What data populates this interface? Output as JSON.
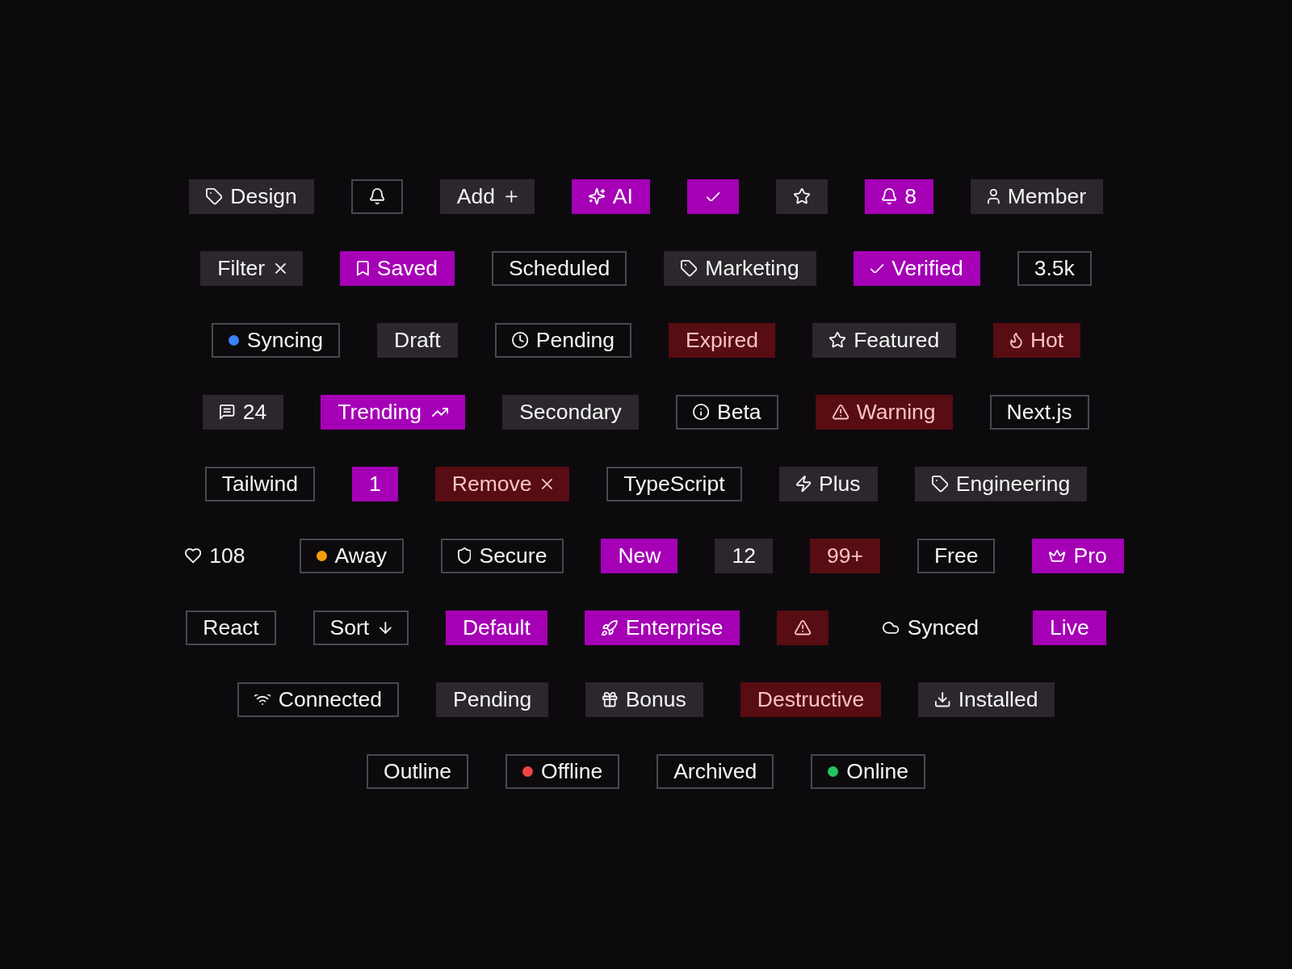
{
  "rows": [
    {
      "badges": [
        {
          "kind": "secondary",
          "label": "Design"
        },
        {
          "kind": "outline"
        },
        {
          "kind": "secondary",
          "label": "Add"
        },
        {
          "kind": "primary",
          "label": "AI"
        },
        {
          "kind": "primary"
        },
        {
          "kind": "secondary"
        },
        {
          "kind": "primary",
          "label": "8"
        },
        {
          "kind": "secondary",
          "label": "Member"
        }
      ]
    },
    {
      "badges": [
        {
          "kind": "secondary",
          "label": "Filter"
        },
        {
          "kind": "primary",
          "label": "Saved"
        },
        {
          "kind": "outline",
          "label": "Scheduled"
        },
        {
          "kind": "secondary",
          "label": "Marketing"
        },
        {
          "kind": "primary",
          "label": "Verified"
        },
        {
          "kind": "outline",
          "label": "3.5k"
        }
      ]
    },
    {
      "badges": [
        {
          "kind": "outline",
          "label": "Syncing",
          "color": "#3b82f6"
        },
        {
          "kind": "secondary",
          "label": "Draft"
        },
        {
          "kind": "outline",
          "label": "Pending"
        },
        {
          "kind": "destructive",
          "label": "Expired"
        },
        {
          "kind": "secondary",
          "label": "Featured"
        },
        {
          "kind": "destructive",
          "label": "Hot"
        }
      ]
    },
    {
      "badges": [
        {
          "kind": "secondary",
          "label": "24"
        },
        {
          "kind": "primary",
          "label": "Trending"
        },
        {
          "kind": "secondary",
          "label": "Secondary"
        },
        {
          "kind": "outline",
          "label": "Beta"
        },
        {
          "kind": "destructive",
          "label": "Warning"
        },
        {
          "kind": "outline",
          "label": "Next.js"
        }
      ]
    },
    {
      "badges": [
        {
          "kind": "outline",
          "label": "Tailwind"
        },
        {
          "kind": "primary",
          "label": "1"
        },
        {
          "kind": "destructive",
          "label": "Remove"
        },
        {
          "kind": "outline",
          "label": "TypeScript"
        },
        {
          "kind": "secondary",
          "label": "Plus"
        },
        {
          "kind": "secondary",
          "label": "Engineering"
        }
      ]
    },
    {
      "badges": [
        {
          "kind": "ghost",
          "label": "108"
        },
        {
          "kind": "outline",
          "label": "Away",
          "color": "#f59e0b"
        },
        {
          "kind": "outline",
          "label": "Secure"
        },
        {
          "kind": "primary",
          "label": "New"
        },
        {
          "kind": "secondary",
          "label": "12"
        },
        {
          "kind": "destructive",
          "label": "99+"
        },
        {
          "kind": "outline",
          "label": "Free"
        },
        {
          "kind": "primary",
          "label": "Pro"
        }
      ]
    },
    {
      "badges": [
        {
          "kind": "outline",
          "label": "React"
        },
        {
          "kind": "outline",
          "label": "Sort"
        },
        {
          "kind": "primary",
          "label": "Default"
        },
        {
          "kind": "primary",
          "label": "Enterprise"
        },
        {
          "kind": "destructive"
        },
        {
          "kind": "ghost",
          "label": "Synced"
        },
        {
          "kind": "primary",
          "label": "Live"
        }
      ]
    },
    {
      "badges": [
        {
          "kind": "outline",
          "label": "Connected"
        },
        {
          "kind": "secondary",
          "label": "Pending"
        },
        {
          "kind": "secondary",
          "label": "Bonus"
        },
        {
          "kind": "destructive",
          "label": "Destructive"
        },
        {
          "kind": "secondary",
          "label": "Installed"
        }
      ]
    },
    {
      "badges": [
        {
          "kind": "outline",
          "label": "Outline"
        },
        {
          "kind": "outline",
          "label": "Offline",
          "color": "#ef4444"
        },
        {
          "kind": "outline",
          "label": "Archived"
        },
        {
          "kind": "outline",
          "label": "Online",
          "color": "#22c55e"
        }
      ]
    }
  ]
}
